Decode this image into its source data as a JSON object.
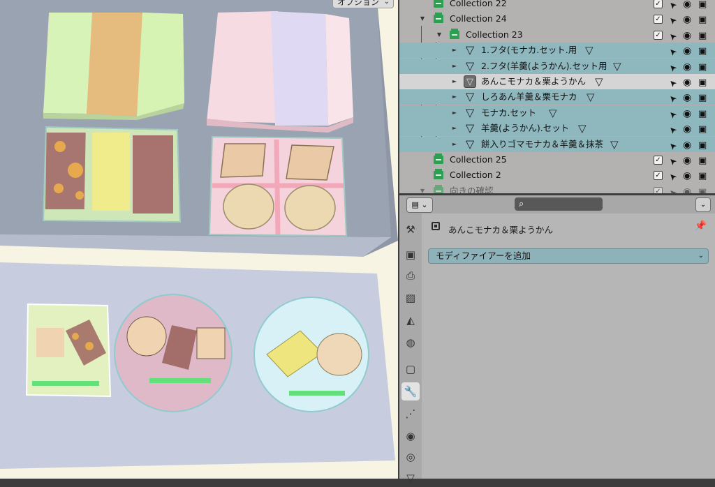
{
  "viewport": {
    "options_label": "オプション",
    "chevron": "⌄"
  },
  "outliner": {
    "rows": [
      {
        "label": "Collection 22",
        "type": "collection",
        "expand": "",
        "checked": true
      },
      {
        "label": "Collection 24",
        "type": "collection",
        "expand": "▼",
        "checked": true
      },
      {
        "label": "Collection 23",
        "type": "collection",
        "expand": "▼",
        "checked": true
      },
      {
        "label": "1.フタ(モナカ.セット.用",
        "type": "mesh",
        "expand": "►",
        "selected": true
      },
      {
        "label": "2.フタ(羊羹(ようかん).セット用",
        "type": "mesh",
        "expand": "►",
        "selected": true
      },
      {
        "label": "あんこモナカ＆栗ようかん",
        "type": "mesh",
        "expand": "►",
        "active": true
      },
      {
        "label": "しろあん羊羹＆栗モナカ",
        "type": "mesh",
        "expand": "►",
        "selected": true
      },
      {
        "label": "モナカ.セット",
        "type": "mesh",
        "expand": "►",
        "selected": true
      },
      {
        "label": "羊羹(ようかん).セット",
        "type": "mesh",
        "expand": "►",
        "selected": true
      },
      {
        "label": "餅入りゴマモナカ＆羊羹＆抹茶",
        "type": "mesh",
        "expand": "►",
        "selected": true
      },
      {
        "label": "Collection 25",
        "type": "collection",
        "expand": "",
        "checked": true
      },
      {
        "label": "Collection 2",
        "type": "collection",
        "expand": "",
        "checked": true
      },
      {
        "label": "向きの確認",
        "type": "collection",
        "expand": "▼",
        "checked": true,
        "faded": true
      }
    ],
    "icons": {
      "checkbox": "checkbox-icon",
      "select": "cursor-arrow-icon",
      "visibility": "eye-icon",
      "render": "camera-icon",
      "modifier": "modifier-icon"
    }
  },
  "properties": {
    "search": {
      "icon": "⌕",
      "placeholder": ""
    },
    "object_name": "あんこモナカ＆栗ようかん",
    "add_modifier_label": "モディファイアーを追加",
    "chevron": "⌄",
    "tabs": [
      {
        "name": "tool-tab",
        "glyph": "⚒"
      },
      {
        "name": "render-tab",
        "glyph": "▣"
      },
      {
        "name": "output-tab",
        "glyph": "⎙"
      },
      {
        "name": "view-layer-tab",
        "glyph": "▨"
      },
      {
        "name": "scene-tab",
        "glyph": "◭"
      },
      {
        "name": "world-tab",
        "glyph": "◍"
      },
      {
        "name": "object-tab",
        "glyph": "▢"
      },
      {
        "name": "modifier-tab",
        "glyph": "🔧",
        "active": true
      },
      {
        "name": "particles-tab",
        "glyph": "⋰"
      },
      {
        "name": "physics-tab",
        "glyph": "◉"
      },
      {
        "name": "constraints-tab",
        "glyph": "◎"
      },
      {
        "name": "data-tab",
        "glyph": "▽"
      }
    ],
    "colors": {
      "selected_row": "#8fb7be",
      "active_row": "#d5d5d5",
      "collection_icon": "#2e9e53",
      "active_tab_icon": "#1c4aa6"
    }
  }
}
